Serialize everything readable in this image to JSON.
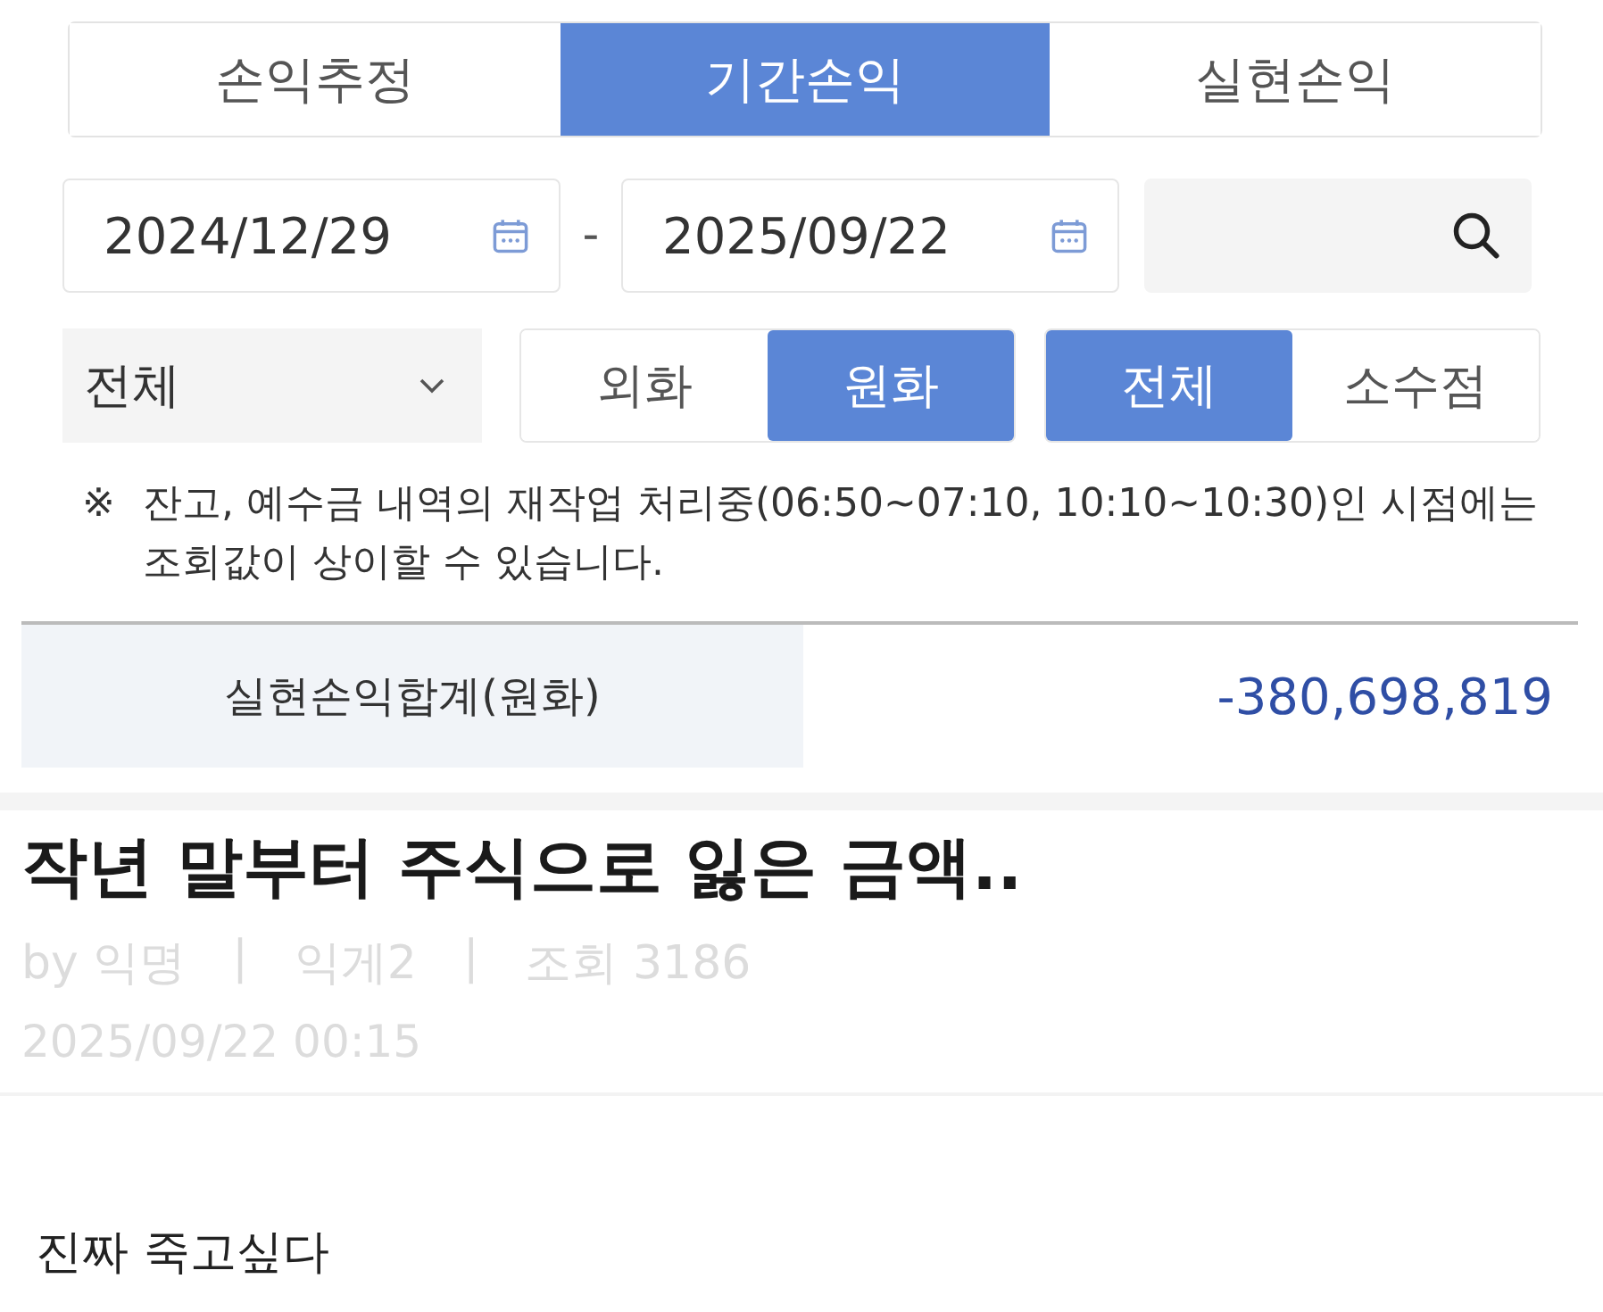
{
  "tabs": [
    {
      "label": "손익추정",
      "selected": false
    },
    {
      "label": "기간손익",
      "selected": true
    },
    {
      "label": "실현손익",
      "selected": false
    }
  ],
  "date_range": {
    "start": "2024/12/29",
    "separator": "-",
    "end": "2025/09/22"
  },
  "filter": {
    "value": "전체"
  },
  "currency_options": [
    {
      "label": "외화",
      "selected": false
    },
    {
      "label": "원화",
      "selected": true
    }
  ],
  "precision_options": [
    {
      "label": "전체",
      "selected": true
    },
    {
      "label": "소수점",
      "selected": false
    }
  ],
  "notice": {
    "mark": "※",
    "text": "잔고, 예수금 내역의 재작업 처리중(06:50~07:10, 10:10~10:30)인 시점에는 조회값이 상이할 수 있습니다."
  },
  "summary": {
    "label": "실현손익합계(원화)",
    "value": "-380,698,819"
  },
  "post": {
    "title": "작년 말부터 주식으로 잃은 금액..",
    "meta": [
      "by 익명",
      "|",
      "익게2",
      "|",
      "조회 3186"
    ],
    "date": "2025/09/22 00:15",
    "body": "진짜 죽고싶다"
  }
}
